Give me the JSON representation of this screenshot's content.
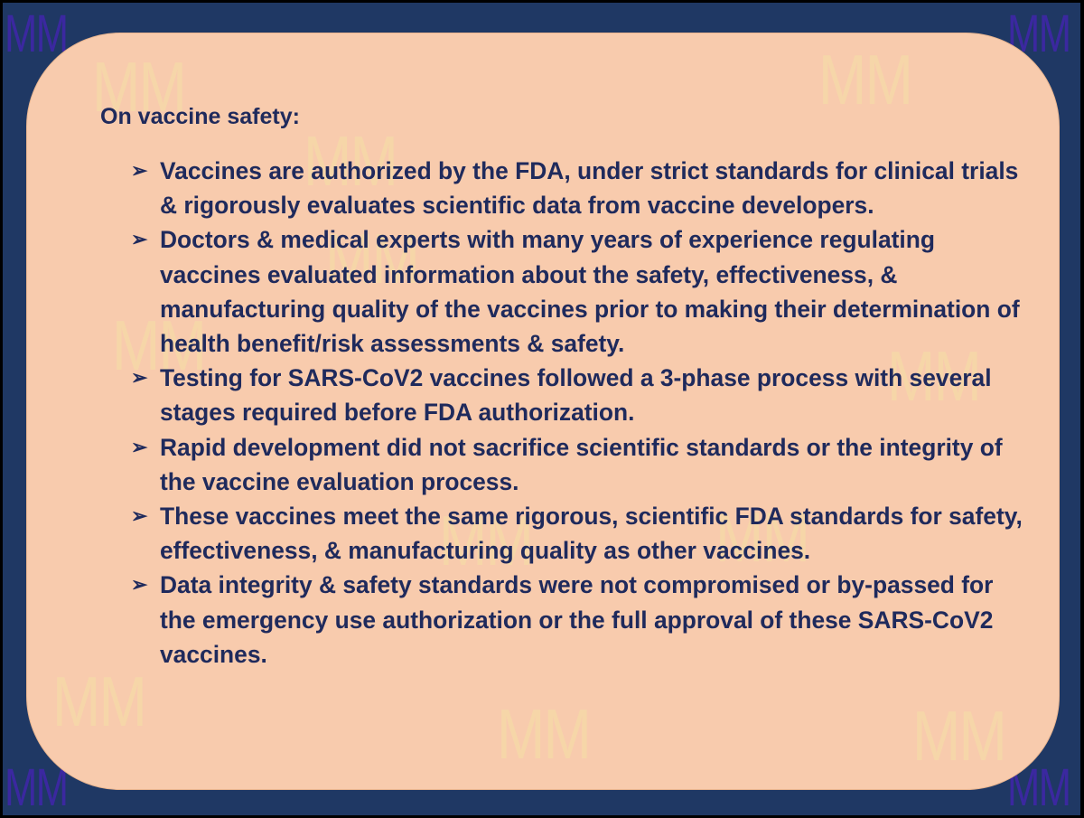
{
  "watermark": "MM",
  "slide": {
    "heading": "On vaccine safety:",
    "bullets": [
      "Vaccines are authorized by the FDA, under strict standards for clinical trials & rigorously evaluates scientific data from vaccine developers.",
      "Doctors & medical experts with many years of experience regulating vaccines evaluated information about the safety, effectiveness, & manufacturing quality of the vaccines prior to making their determination of health benefit/risk assessments & safety.",
      "Testing for SARS-CoV2 vaccines followed a 3-phase process with several stages required before FDA authorization.",
      "Rapid development did not sacrifice scientific standards or the integrity of the vaccine evaluation process.",
      "These vaccines meet the same rigorous, scientific FDA standards for safety, effectiveness, & manufacturing quality as other vaccines.",
      "Data integrity & safety standards were not compromised or by-passed for the emergency use authorization or the full approval of these SARS-CoV2 vaccines."
    ],
    "bullet_glyph": "➢"
  },
  "colors": {
    "frame": "#1f3864",
    "card": "#f8cbad",
    "text": "#1f2a5c",
    "watermark_light": "#f6d9a8",
    "watermark_dark": "#3b28a0"
  }
}
